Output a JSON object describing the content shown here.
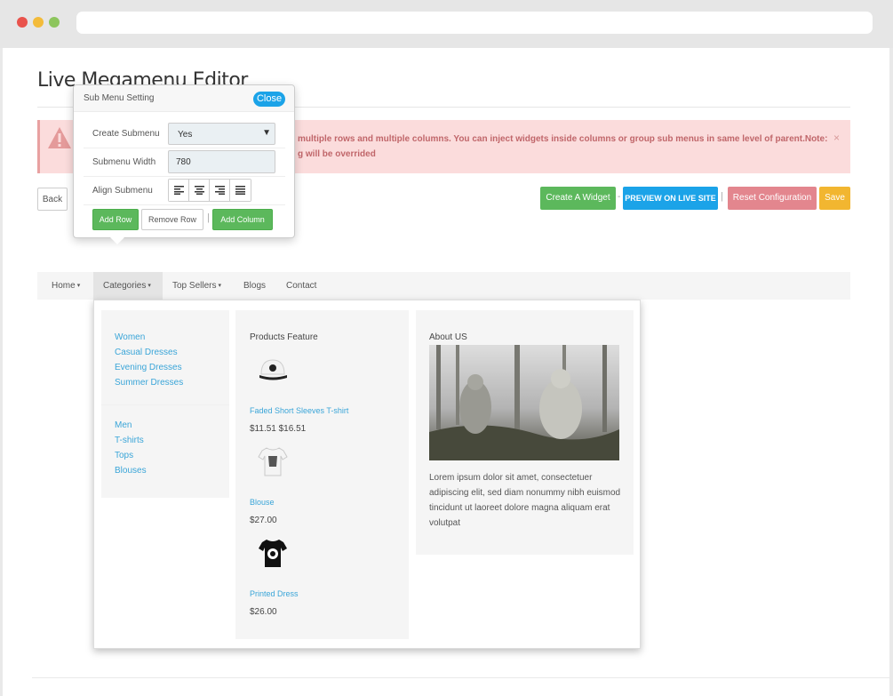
{
  "page": {
    "title": "Live Megamenu Editor"
  },
  "alert": {
    "text": "multiple rows and multiple columns. You can inject widgets inside columns or group sub menus in same level of parent.Note: g will be overrided",
    "close": "×"
  },
  "toolbar": {
    "back": "Back",
    "create_widget": "Create A Widget",
    "sep1": "-",
    "preview": "PREVIEW ON LIVE SITE",
    "sep2": "|",
    "reset": "Reset Configuration",
    "save": "Save"
  },
  "popup": {
    "title": "Sub Menu Setting",
    "close": "Close",
    "create_submenu_label": "Create Submenu",
    "create_submenu_value": "Yes",
    "submenu_width_label": "Submenu Width",
    "submenu_width_value": "780",
    "align_label": "Align Submenu",
    "add_row": "Add Row",
    "remove_row": "Remove Row",
    "sep": "|",
    "add_column": "Add Column"
  },
  "nav": {
    "items": [
      {
        "label": "Home",
        "has_caret": true
      },
      {
        "label": "Categories",
        "has_caret": true,
        "active": true
      },
      {
        "label": "Top Sellers",
        "has_caret": true
      },
      {
        "label": "Blogs",
        "has_caret": false
      },
      {
        "label": "Contact",
        "has_caret": false
      }
    ],
    "caret": "▾"
  },
  "mega": {
    "col1": {
      "group1": [
        "Women",
        "Casual Dresses",
        "Evening Dresses",
        "Summer Dresses"
      ],
      "group2": [
        "Men",
        "T-shirts",
        "Tops",
        "Blouses"
      ]
    },
    "col2": {
      "heading": "Products Feature",
      "products": [
        {
          "name": "Faded Short Sleeves T-shirt",
          "price": "$11.51 $16.51",
          "icon": "cap-icon"
        },
        {
          "name": "Blouse",
          "price": "$27.00",
          "icon": "tshirt-white-icon"
        },
        {
          "name": "Printed Dress",
          "price": "$26.00",
          "icon": "tshirt-black-icon"
        }
      ]
    },
    "col3": {
      "heading": "About US",
      "text": "Lorem ipsum dolor sit amet, consectetuer adipiscing elit, sed diam nonummy nibh euismod tincidunt ut laoreet dolore magna aliquam erat volutpat"
    }
  },
  "colors": {
    "green": "#5cb85c",
    "blue": "#1ba3e8",
    "red": "#e3868e",
    "orange": "#f2b630",
    "link": "#3aa5d8"
  }
}
